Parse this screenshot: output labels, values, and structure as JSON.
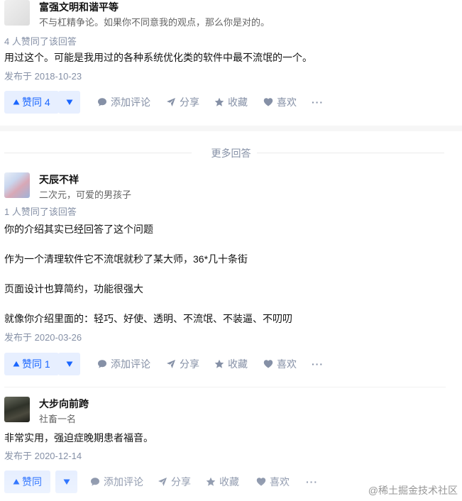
{
  "answers": [
    {
      "author_name": "富强文明和谐平等",
      "author_bio": "不与杠精争论。如果你不同意我的观点，那么你是对的。",
      "voters": "4 人赞同了该回答",
      "paragraphs": [
        "用过这个。可能是我用过的各种系统优化类的软件中最不流氓的一个。"
      ],
      "date": "发布于 2018-10-23",
      "vote_label": "赞同 4"
    },
    {
      "author_name": "天辰不祥",
      "author_bio": "二次元，可爱的男孩子",
      "voters": "1 人赞同了该回答",
      "paragraphs": [
        "你的介绍其实已经回答了这个问题",
        "作为一个清理软件它不流氓就秒了某大师，36*几十条街",
        "页面设计也算简约，功能很强大",
        "就像你介绍里面的：轻巧、好使、透明、不流氓、不装逼、不叨叨"
      ],
      "date": "发布于 2020-03-26",
      "vote_label": "赞同 1"
    },
    {
      "author_name": "大步向前跨",
      "author_bio": "社畜一名",
      "paragraphs": [
        "非常实用，强迫症晚期患者福音。"
      ],
      "date": "发布于 2020-12-14",
      "vote_label": "赞同"
    }
  ],
  "actions": {
    "comment": "添加评论",
    "share": "分享",
    "collect": "收藏",
    "like": "喜欢",
    "more": "···"
  },
  "divider_label": "更多回答",
  "watermark": "@稀土掘金技术社区",
  "colors": {
    "accent": "#1a66ff",
    "vote_bg": "#e7efff",
    "meta": "#8590a6"
  },
  "icons": [
    "caret-up-icon",
    "caret-down-icon",
    "comment-icon",
    "share-icon",
    "star-icon",
    "heart-icon",
    "more-icon"
  ]
}
